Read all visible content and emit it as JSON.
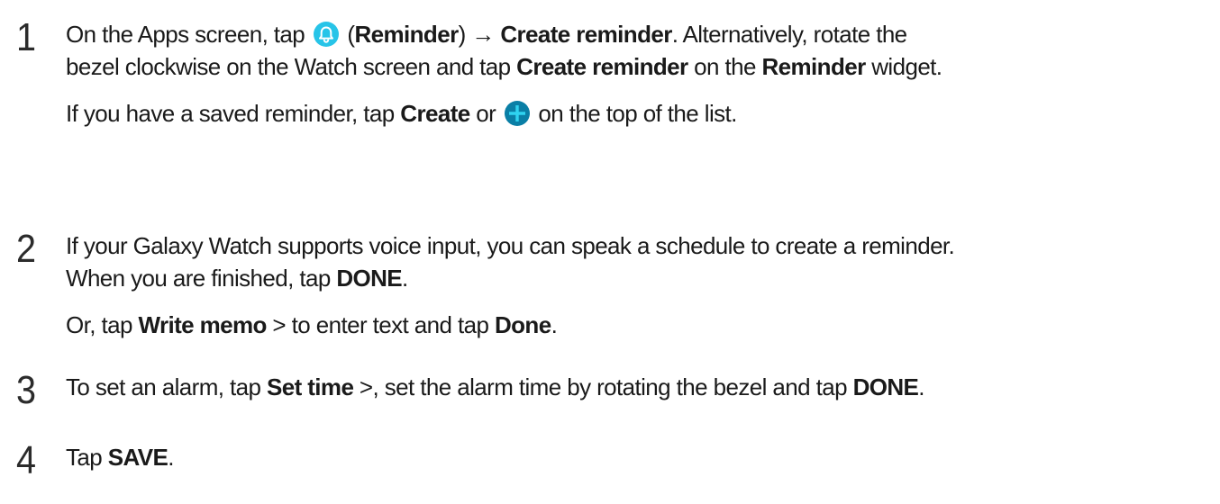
{
  "steps": [
    {
      "number": "1",
      "line1": {
        "a": "On the Apps screen, tap ",
        "icon": "bell-icon",
        "b": " (",
        "c": "Reminder",
        "d": ") → ",
        "e": "Create reminder",
        "f": ". Alternatively, rotate the"
      },
      "line2": {
        "a": "bezel clockwise on the Watch screen and tap ",
        "b": "Create reminder",
        "c": " on the ",
        "d": "Reminder",
        "e": " widget."
      },
      "line3": {
        "a": "If you have a saved reminder, tap ",
        "b": "Create",
        "c": " or ",
        "icon": "plus-icon",
        "d": " on the top of the list."
      }
    },
    {
      "number": "2",
      "line1": "If your Galaxy Watch supports voice input, you can speak a schedule to create a reminder.",
      "line2": {
        "a": "When you are finished, tap ",
        "b": "DONE",
        "c": "."
      },
      "line3": {
        "a": "Or, tap ",
        "b": "Write memo",
        "c": " > to enter text and tap ",
        "d": "Done",
        "e": "."
      }
    },
    {
      "number": "3",
      "line1": {
        "a": "To set an alarm, tap ",
        "b": "Set time",
        "c": " >, set the alarm time by rotating the bezel and tap ",
        "d": "DONE",
        "e": "."
      }
    },
    {
      "number": "4",
      "line1": {
        "a": "Tap ",
        "b": "SAVE",
        "c": "."
      }
    }
  ],
  "colors": {
    "bell_icon_bg": "#27c4e8",
    "plus_icon_bg": "#0a7fa6",
    "text": "#1a1a1a"
  }
}
